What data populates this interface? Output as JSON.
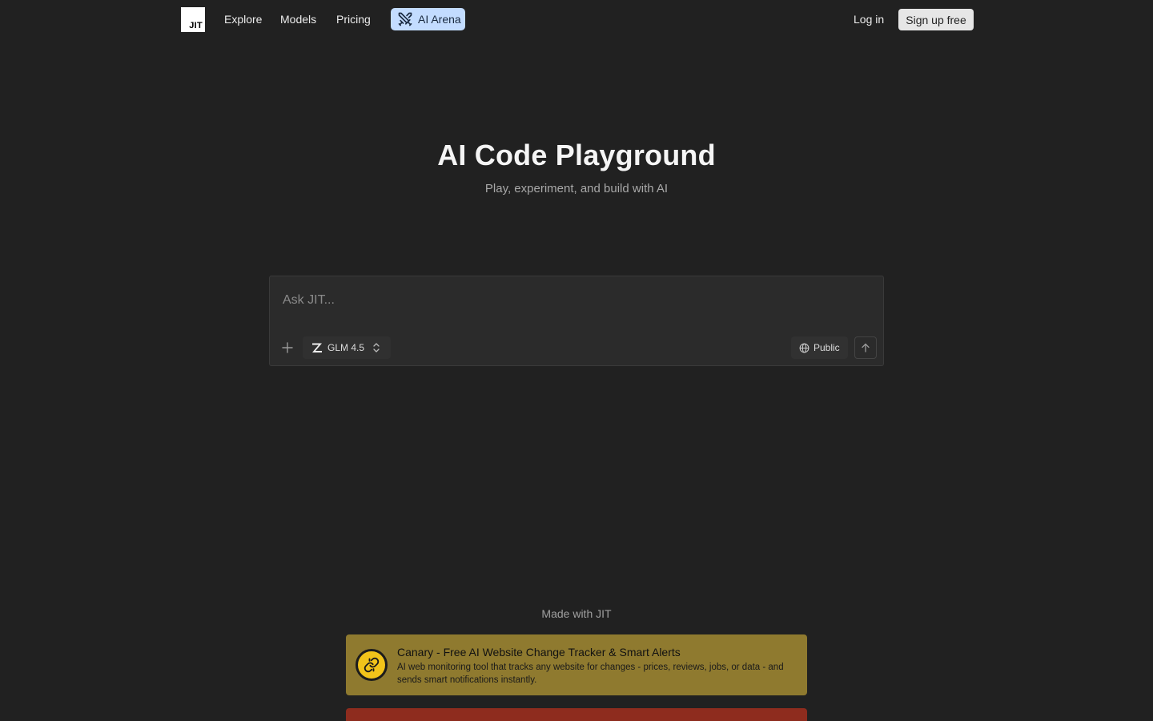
{
  "header": {
    "logo_text": "JIT",
    "nav": [
      "Explore",
      "Models",
      "Pricing"
    ],
    "arena_label": "AI Arena",
    "login_label": "Log in",
    "signup_label": "Sign up free"
  },
  "hero": {
    "title": "AI Code Playground",
    "subtitle": "Play, experiment, and build with AI"
  },
  "prompt": {
    "placeholder": "Ask JIT...",
    "value": "",
    "model": "GLM 4.5",
    "visibility": "Public",
    "icons": {
      "add": "plus-icon",
      "model": "zhipu-logo-icon",
      "selector": "chevron-up-down-icon",
      "visibility": "globe-icon",
      "send": "arrow-up-icon"
    }
  },
  "showcase": {
    "heading": "Made with JIT",
    "cards": [
      {
        "title": "Canary - Free AI Website Change Tracker & Smart Alerts",
        "description": "AI web monitoring tool that tracks any website for changes - prices, reviews, jobs, or data - and sends smart notifications instantly.",
        "icon": "link-icon",
        "color": "#8f7a2f"
      },
      {
        "color": "#8e2c1e"
      }
    ]
  },
  "colors": {
    "background": "#212121",
    "arena_accent": "#c3dcff",
    "signup_bg": "#e6e6e6"
  }
}
